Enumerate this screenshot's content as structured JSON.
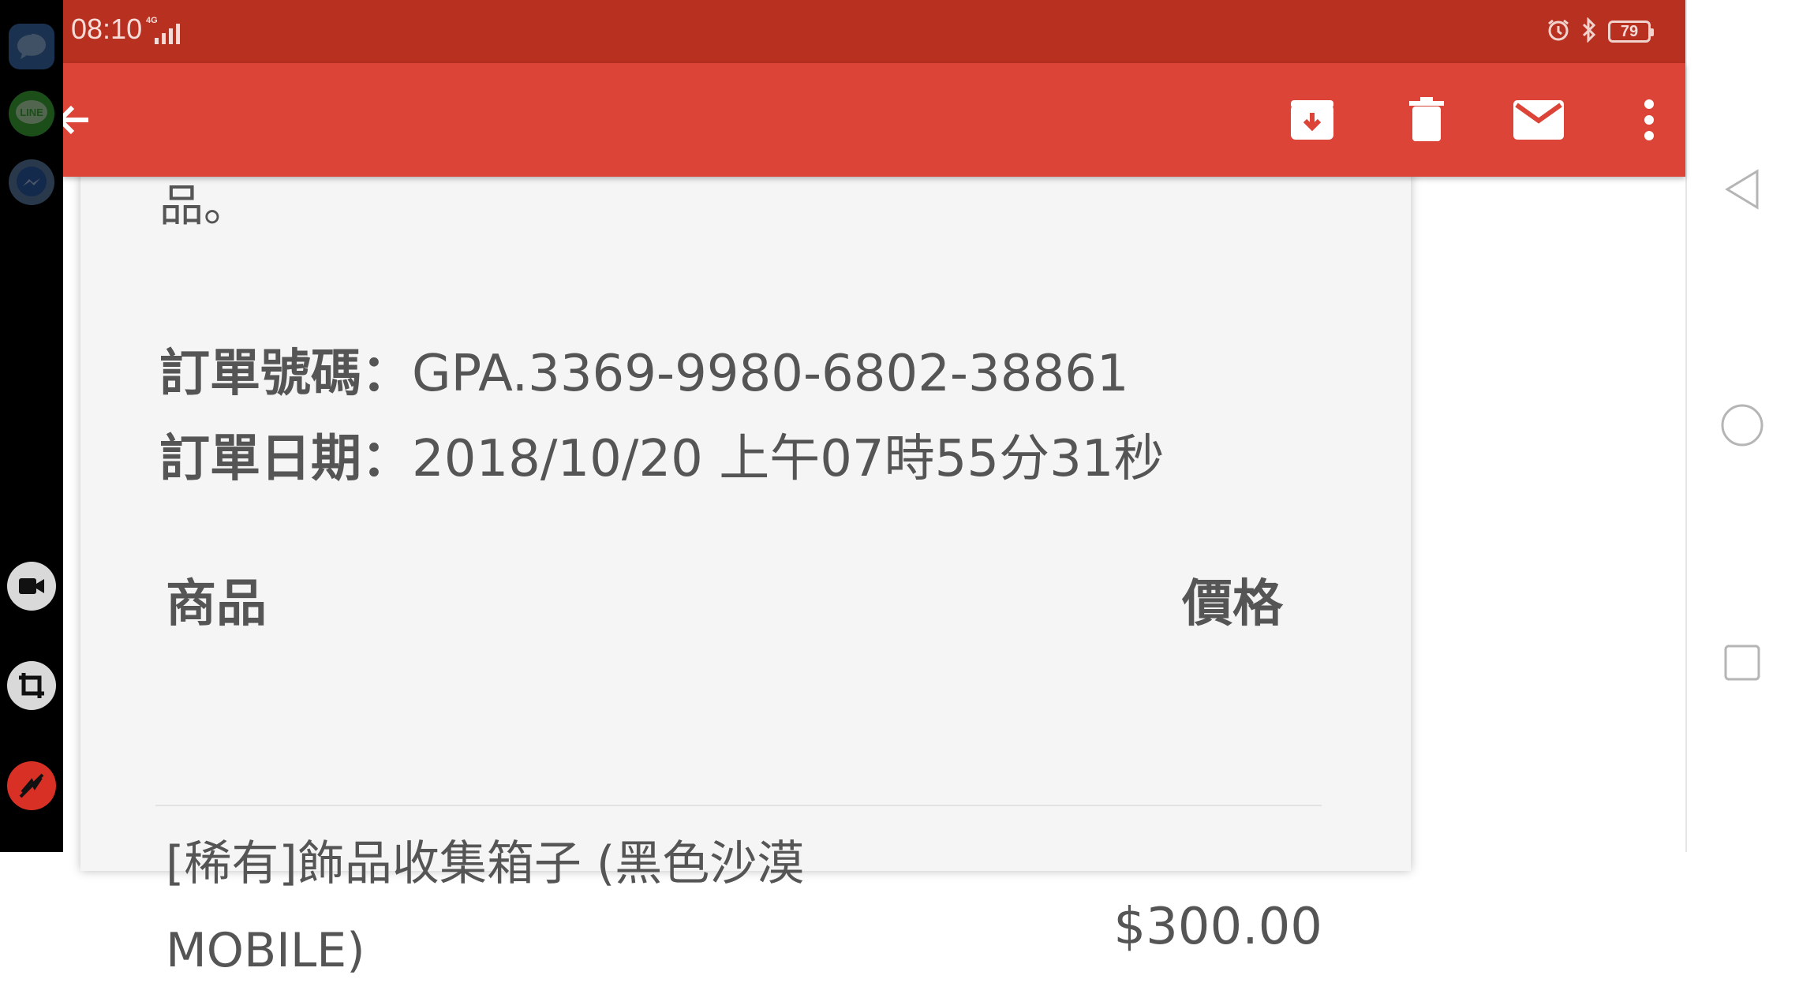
{
  "status_bar": {
    "time": "08:10",
    "network": "4G",
    "battery": "79"
  },
  "toolbar": {
    "back_icon": "arrow-back-icon",
    "actions": [
      "archive-icon",
      "delete-icon",
      "mail-icon",
      "more-vert-icon"
    ]
  },
  "email": {
    "trailing_text": "品。",
    "order_number_label": "訂單號碼：",
    "order_number": "GPA.3369-9980-6802-38861",
    "order_date_label": "訂單日期：",
    "order_date": "2018/10/20 上午07時55分31秒",
    "table": {
      "col_item": "商品",
      "col_price": "價格",
      "rows": [
        {
          "line1": "[稀有]飾品收集箱子 (黑色沙漠",
          "line2": "MOBILE)",
          "price": "$300.00"
        }
      ]
    }
  },
  "left_sidebar": {
    "apps": [
      "messages-icon",
      "line-icon",
      "messenger-icon"
    ],
    "line_text": "LINE",
    "tools": [
      "video-record-icon",
      "crop-icon",
      "disable-icon"
    ]
  },
  "nav_bar": [
    "back-triangle-icon",
    "home-circle-icon",
    "recents-square-icon"
  ],
  "colors": {
    "status_bar": "#b83020",
    "toolbar": "#db4437",
    "card_bg": "#f5f5f5",
    "text": "#555555"
  }
}
